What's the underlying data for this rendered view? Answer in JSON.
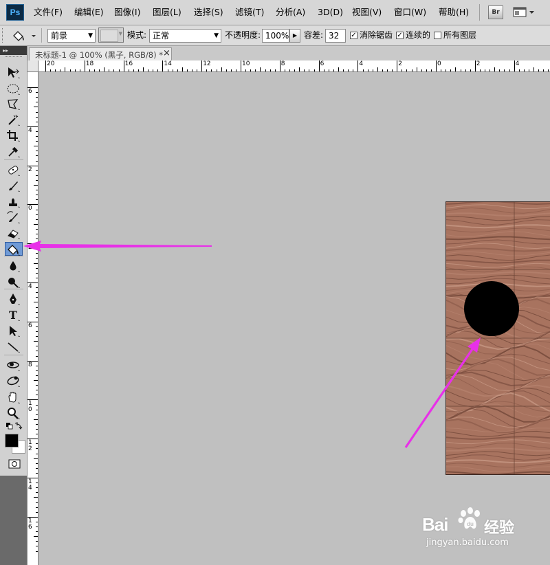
{
  "app": {
    "logo": "Ps"
  },
  "menu": [
    "文件(F)",
    "编辑(E)",
    "图像(I)",
    "图层(L)",
    "选择(S)",
    "滤镜(T)",
    "分析(A)",
    "3D(D)",
    "视图(V)",
    "窗口(W)",
    "帮助(H)"
  ],
  "menu_right": {
    "bridge_label": "Br"
  },
  "options": {
    "fill_source": "前景",
    "mode_label": "模式:",
    "mode_value": "正常",
    "opacity_label": "不透明度:",
    "opacity_value": "100%",
    "tolerance_label": "容差:",
    "tolerance_value": "32",
    "antialias_label": "消除锯齿",
    "antialias_checked": true,
    "contiguous_label": "连续的",
    "contiguous_checked": true,
    "all_layers_label": "所有图层",
    "all_layers_checked": false
  },
  "document": {
    "tab_title": "未标题-1 @ 100% (黑子, RGB/8) *",
    "close_glyph": "×"
  },
  "ruler": {
    "top_labels": [
      "20",
      "18",
      "16",
      "14",
      "12",
      "10",
      "8",
      "6",
      "4",
      "2",
      "0",
      "2",
      "4"
    ],
    "left_labels": [
      "6",
      "4",
      "2",
      "0",
      "2",
      "4",
      "6",
      "8",
      "1 0",
      "1 2",
      "1 4",
      "1 6"
    ]
  },
  "tools": [
    "move-icon",
    "ellipse-marquee-icon",
    "lasso-icon",
    "magic-wand-icon",
    "crop-icon",
    "eyedropper-icon",
    "healing-brush-icon",
    "brush-icon",
    "clone-stamp-icon",
    "history-brush-icon",
    "eraser-icon",
    "paint-bucket-icon",
    "blur-icon",
    "dodge-icon",
    "pen-icon",
    "type-icon",
    "path-select-icon",
    "line-icon",
    "3d-rotate-icon",
    "3d-orbit-icon",
    "hand-icon",
    "zoom-icon"
  ],
  "watermark": {
    "brand_left": "Bai",
    "brand_right": "经验",
    "url": "jingyan.baidu.com"
  },
  "colors": {
    "foreground": "#000000",
    "background": "#ffffff",
    "arrow": "#e830e8",
    "wood": "#a8735f"
  }
}
